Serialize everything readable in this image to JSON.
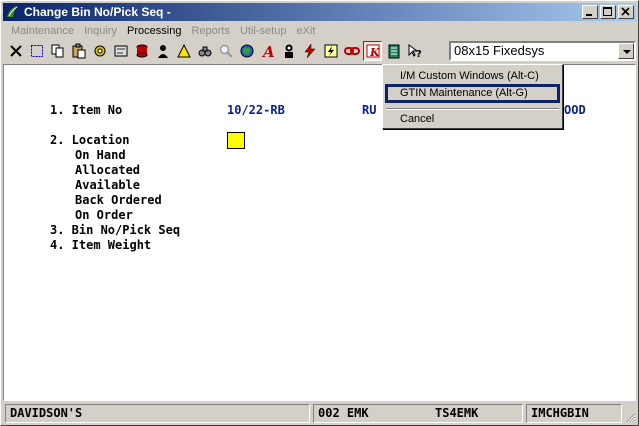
{
  "window": {
    "title": "Change Bin No/Pick Seq -"
  },
  "menu": [
    {
      "label": "Maintenance",
      "active": false
    },
    {
      "label": "Inquiry",
      "active": false
    },
    {
      "label": "Processing",
      "active": true
    },
    {
      "label": "Reports",
      "active": false
    },
    {
      "label": "Util-setup",
      "active": false
    },
    {
      "label": "eXit",
      "active": false
    }
  ],
  "toolbar": {
    "font_select_value": "08x15 Fixedsys"
  },
  "form": {
    "item_no_label": "1. Item No",
    "item_no_value": "10/22-RB",
    "item_desc_left": "RU",
    "item_desc_right": "OOD",
    "location_label": "2. Location",
    "on_hand_label": "On Hand",
    "allocated_label": "Allocated",
    "available_label": "Available",
    "back_ordered_label": "Back Ordered",
    "on_order_label": "On Order",
    "bin_label": "3. Bin No/Pick Seq",
    "weight_label": "4. Item Weight"
  },
  "dropdown": {
    "items": [
      {
        "label": "I/M Custom Windows  (Alt-C)"
      },
      {
        "label": "GTIN Maintenance  (Alt-G)"
      },
      {
        "label": "Cancel"
      }
    ]
  },
  "status": {
    "company": "DAVIDSON'S",
    "company_code": "002 EMK",
    "terminal": "TS4EMK",
    "program": "IMCHGBIN"
  },
  "colors": {
    "titlebar_start": "#0a246a",
    "titlebar_end": "#a6caf0",
    "field_value": "#0a1e8c",
    "highlight_box": "#ffff00"
  }
}
